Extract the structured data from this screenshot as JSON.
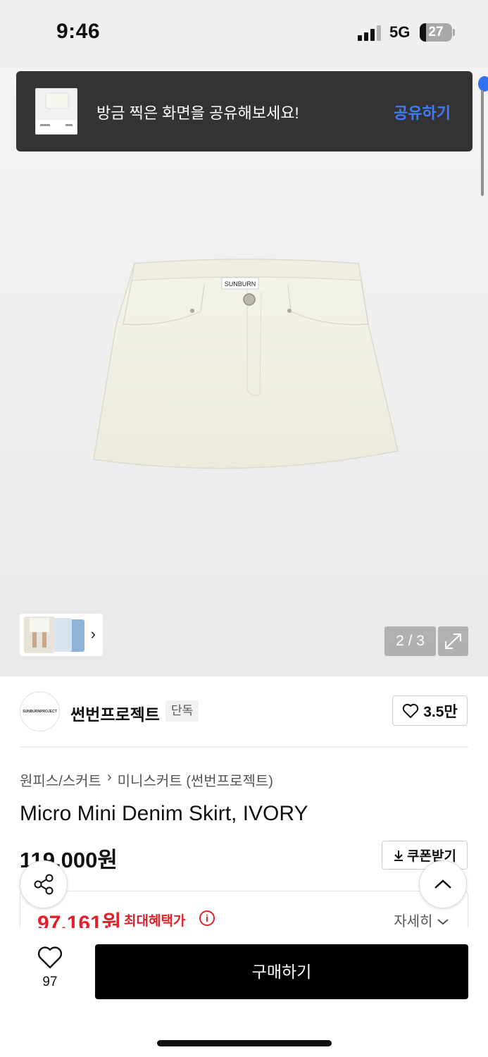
{
  "status_bar": {
    "time": "9:46",
    "network": "5G",
    "battery": "27"
  },
  "toast": {
    "message": "방금 찍은 화면을 공유해보세요!",
    "action": "공유하기"
  },
  "gallery": {
    "pager": "2 / 3",
    "thumbnail_arrow": "›"
  },
  "brand": {
    "logo_text": "SUNBURNPROJECT",
    "name": "썬번프로젝트",
    "badge": "단독",
    "likes": "3.5만"
  },
  "breadcrumb": {
    "category": "원피스/스커트",
    "separator": "›",
    "subcategory": "미니스커트 (썬번프로젝트)"
  },
  "product": {
    "title": "Micro Mini Denim Skirt, IVORY",
    "label_text": "SUNBURN",
    "price": "119,000원",
    "coupon_label": "쿠폰받기",
    "benefit_price": "97,161원",
    "benefit_label": "최대혜택가",
    "benefit_info": "i",
    "details_label": "자세히"
  },
  "bottom_bar": {
    "wish_count": "97",
    "buy_label": "구매하기"
  },
  "colors": {
    "accent_blue": "#3f7cf5",
    "sale_red": "#e0202a",
    "buy_black": "#000000",
    "toast_bg": "#333335"
  }
}
